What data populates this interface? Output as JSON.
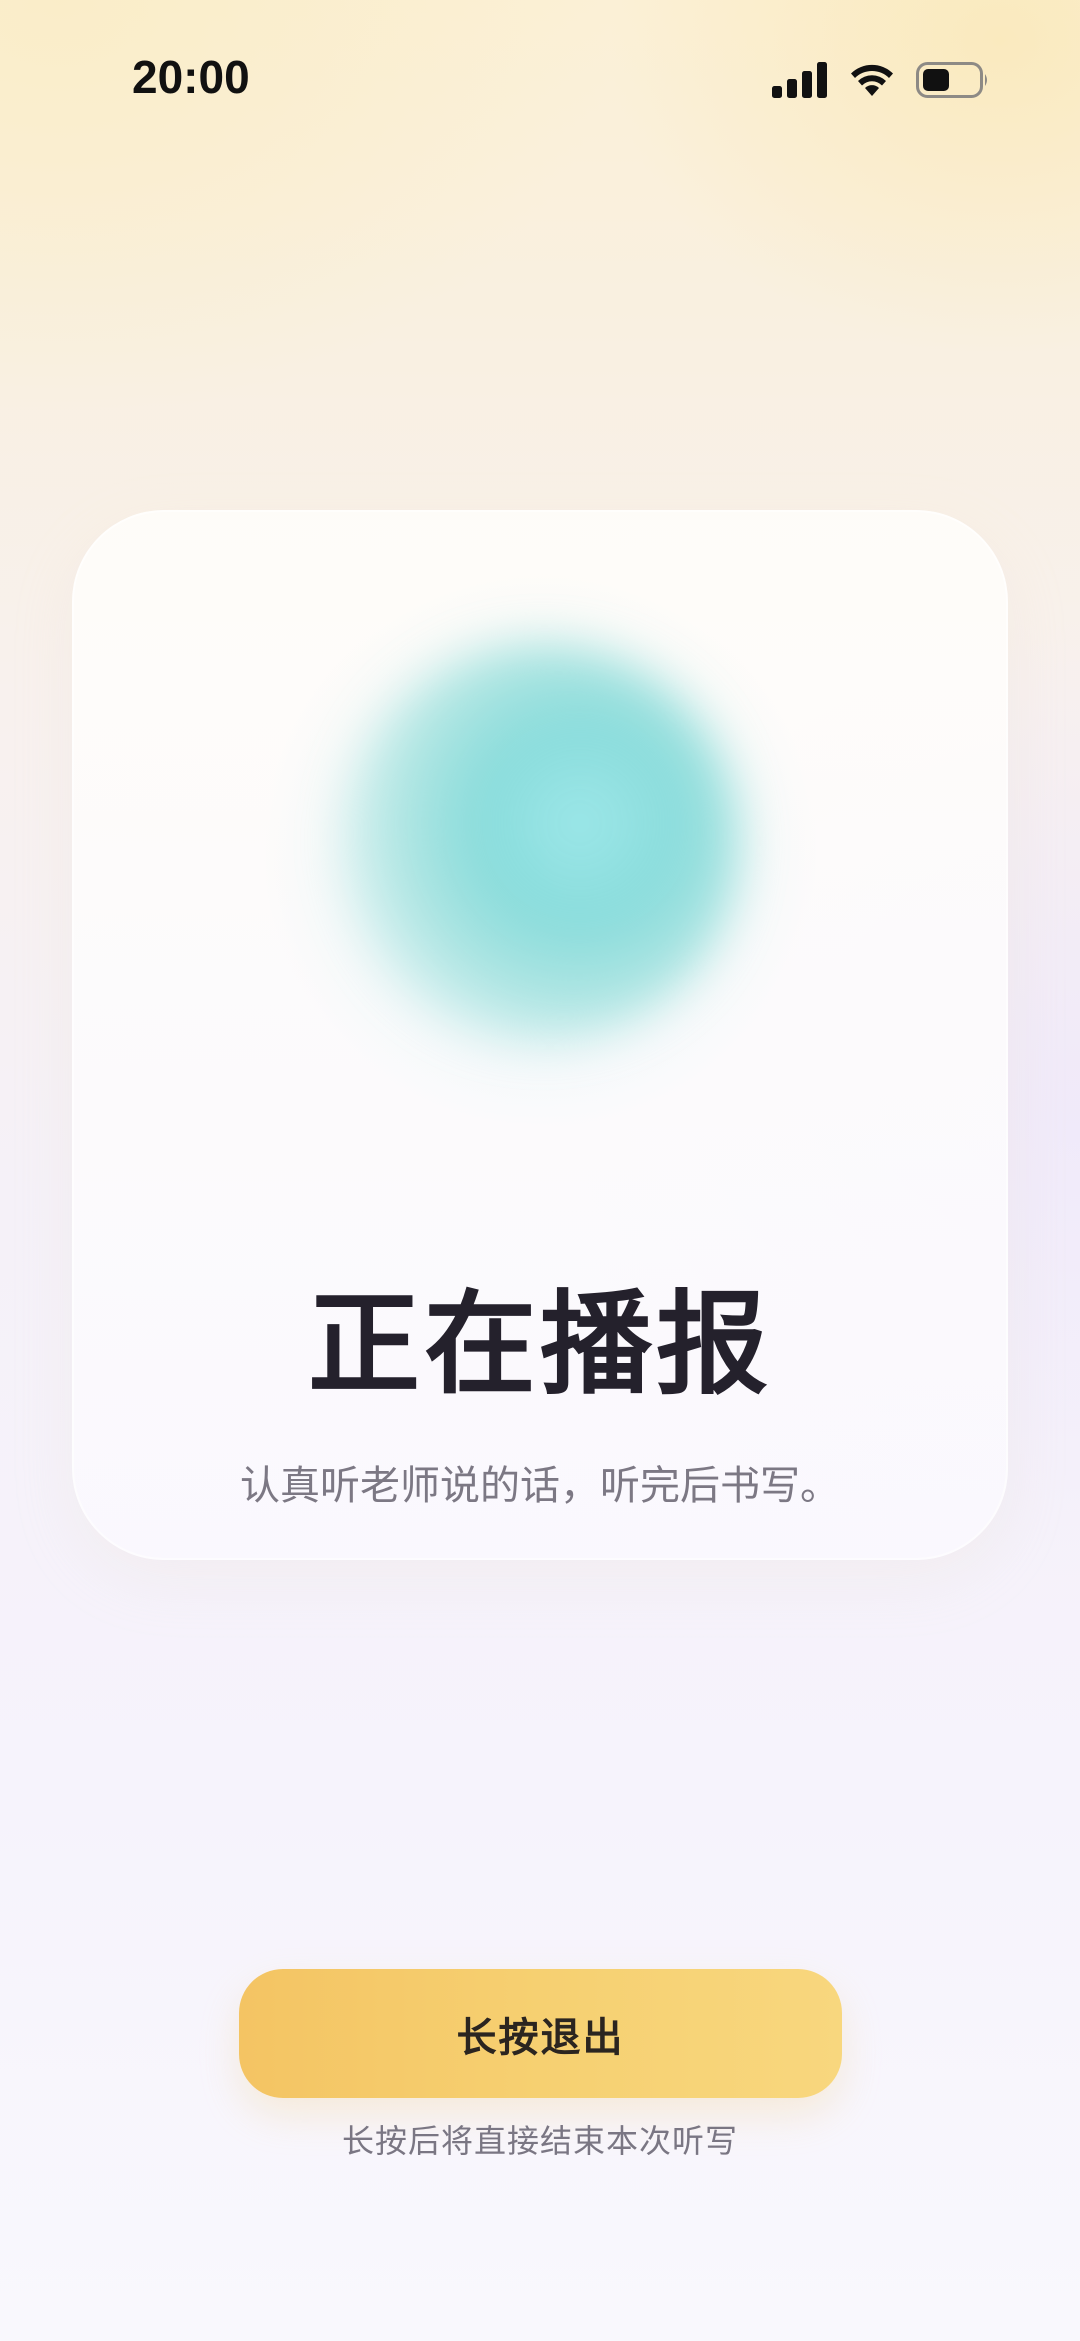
{
  "status_bar": {
    "time": "20:00",
    "icons": [
      "cellular-signal-icon",
      "wifi-icon",
      "battery-icon"
    ]
  },
  "card": {
    "title": "正在播报",
    "subtitle": "认真听老师说的话，听完后书写。",
    "orb_color": "#7fd9d6"
  },
  "exit": {
    "button_label": "长按退出",
    "hint": "长按后将直接结束本次听写",
    "button_color": "#f5cb6a"
  }
}
